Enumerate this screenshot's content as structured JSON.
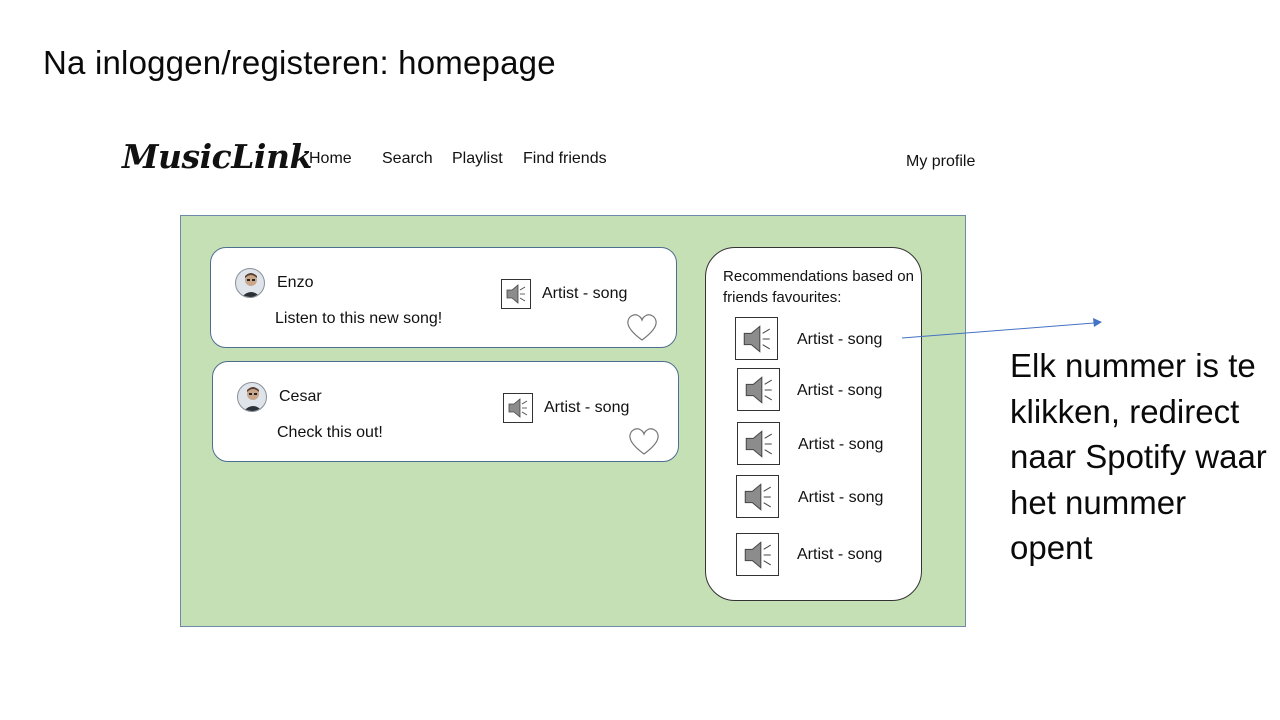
{
  "slide": {
    "title": "Na inloggen/registeren:  homepage"
  },
  "header": {
    "logo": "MusicLink",
    "nav": [
      "Home",
      "Search",
      "Playlist",
      "Find friends"
    ],
    "profile": "My profile"
  },
  "feed": {
    "posts": [
      {
        "name": "Enzo",
        "message": "Listen to this new song!",
        "song": "Artist - song"
      },
      {
        "name": "Cesar",
        "message": "Check this out!",
        "song": "Artist - song"
      }
    ]
  },
  "recommendations": {
    "title": "Recommendations based on friends favourites:",
    "items": [
      "Artist - song",
      "Artist - song",
      "Artist - song",
      "Artist - song",
      "Artist - song"
    ]
  },
  "annotation": {
    "text": "Elk nummer is te klikken, redirect naar Spotify waar het nummer opent"
  },
  "colors": {
    "panel": "#c5e0b4",
    "card": "#ffffff",
    "arrow": "#4472c4"
  },
  "icons": {
    "speaker": "speaker-icon",
    "heart": "heart-icon",
    "avatar": "avatar-icon"
  }
}
